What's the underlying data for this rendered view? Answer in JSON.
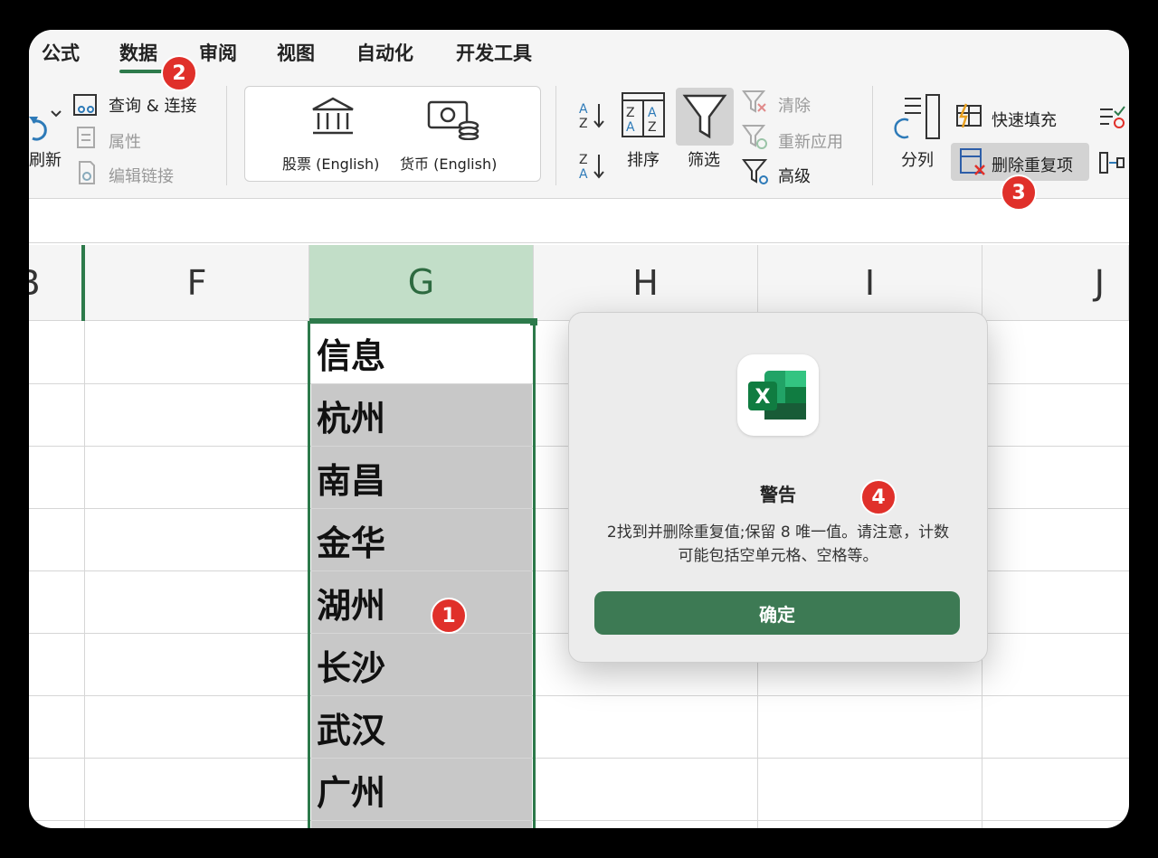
{
  "tabs": [
    "公式",
    "数据",
    "审阅",
    "视图",
    "自动化",
    "开发工具"
  ],
  "ribbon": {
    "refresh_label": "刷新",
    "query_label": "查询 & 连接",
    "properties_label": "属性",
    "edit_links_label": "编辑链接",
    "stocks_label": "股票 (English)",
    "currency_label": "货币 (English)",
    "sort_label": "排序",
    "filter_label": "筛选",
    "clear_label": "清除",
    "reapply_label": "重新应用",
    "advanced_label": "高级",
    "split_label": "分列",
    "flash_fill_label": "快速填充",
    "remove_duplicates_label": "删除重复项"
  },
  "columns": [
    "B",
    "F",
    "G",
    "H",
    "I",
    "J"
  ],
  "cells": [
    "信息",
    "杭州",
    "南昌",
    "金华",
    "湖州",
    "长沙",
    "武汉",
    "广州"
  ],
  "dialog": {
    "title": "警告",
    "message": "2找到并删除重复值;保留 8 唯一值。请注意，计数可能包括空单元格、空格等。",
    "ok_label": "确定"
  },
  "badges": [
    "1",
    "2",
    "3",
    "4"
  ],
  "colors": {
    "accent": "#2d7a4b",
    "badge": "#e0302a",
    "button": "#3d7a54"
  }
}
